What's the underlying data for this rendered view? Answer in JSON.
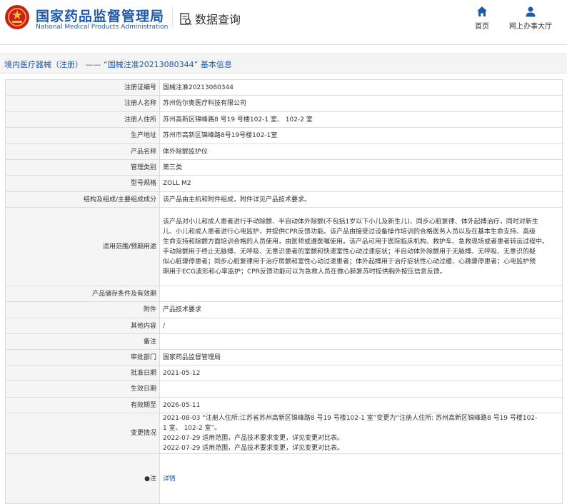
{
  "header": {
    "org_cn": "国家药品监督管理局",
    "org_en": "National Medical Products Administration",
    "query_label": "数据查询",
    "nav": [
      {
        "label": "首页",
        "icon": "home-icon"
      },
      {
        "label": "网上办事大厅",
        "icon": "user-icon"
      }
    ],
    "colors": {
      "brand": "#1f5aa6",
      "emblem": "#c8201e"
    }
  },
  "title": "境内医疗器械（注册） —— “国械注准20213080344” 基本信息",
  "rows": [
    {
      "key": "注册证编号",
      "value": "国械注准20213080344"
    },
    {
      "key": "注册人名称",
      "value": "苏州佐尔奥医疗科技有限公司"
    },
    {
      "key": "注册人住所",
      "value": "苏州高新区锦峰路8 号19 号楼102-1 室、 102-2 室"
    },
    {
      "key": "生产地址",
      "value": "苏州市高新区锦峰路8号19号楼102-1室"
    },
    {
      "key": "产品名称",
      "value": "体外除颤监护仪"
    },
    {
      "key": "管理类别",
      "value": "第三类"
    },
    {
      "key": "型号规格",
      "value": "ZOLL M2"
    },
    {
      "key": "结构及组成/主要组成成分",
      "value": "该产品由主机和附件组成，附件详见产品技术要求。"
    },
    {
      "key": "适用范围/预期用途",
      "lines": [
        "该产品对小儿和成人患者进行手动除颤、半自动体外除颤(不包括1岁以下小儿及新生儿)、同步心脏复律、体外起搏治疗，同时对新生",
        "儿、小儿和成人患者进行心电监护，并提供CPR反馈功能。该产品由接受过设备操作培训的合格医务人员以及在基本生命支持、高级",
        "生命支持和除颤方面培训合格的人员使用，由医师或遵医嘱使用。该产品可用于医院临床机构、救护车、急救现场或者患者转运过程中。",
        "手动除颤用于终止无脉搏、无呼吸、无意识患者的室颤和快速室性心动过速症状；半自动体外除颤用于无脉搏、无呼吸、无意识的疑",
        "似心脏骤停患者；同步心脏复律用于治疗房颤和室性心动过速患者；体外起搏用于治疗症状性心动过缓、心跳骤停患者；心电监护预",
        "期用于ECG波形和心率监护；CPR反馈功能可以为急救人员在做心肺复苏时提供胸外按压信息反馈。"
      ]
    },
    {
      "key": "产品储存条件及有效期",
      "value": ""
    },
    {
      "key": "附件",
      "value": "产品技术要求"
    },
    {
      "key": "其他内容",
      "value": "/"
    },
    {
      "key": "备注",
      "value": ""
    },
    {
      "key": "审批部门",
      "value": "国家药品监督管理局"
    },
    {
      "key": "批准日期",
      "value": "2021-05-12"
    },
    {
      "key": "生效日期",
      "value": ""
    },
    {
      "key": "有效期至",
      "value": "2026-05-11"
    },
    {
      "key": "变更情况",
      "lines": [
        "2021-08-03 “注册人住所:江苏省苏州高新区锦峰路8 号19 号楼102-1 室”变更为“注册人住所: 苏州高新区锦峰路8 号19 号楼102-",
        "1 室、 102-2 室”。",
        "2022-07-29 适用范围，产品技术要求变更，详见变更对比表。",
        "2022-07-29 适用范围，产品技术要求变更，详见变更对比表。"
      ]
    },
    {
      "key": "●注",
      "value": "详情",
      "link": true
    }
  ]
}
